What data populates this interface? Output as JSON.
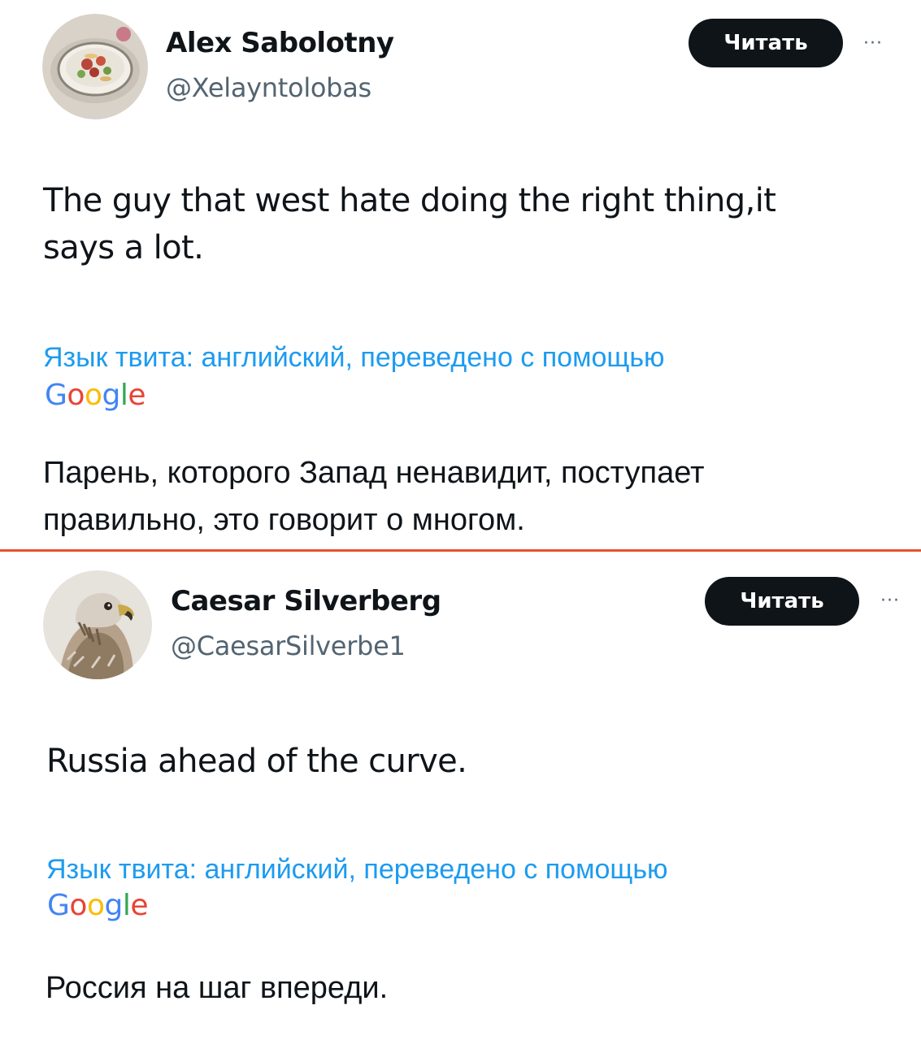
{
  "tweets": [
    {
      "display_name": "Alex Sabolotny",
      "handle": "@Xelayntolobas",
      "follow_label": "Читать",
      "more_label": "···",
      "text_line_1": "The guy that west hate doing the right thing,it",
      "text_line_2": "says a lot.",
      "translation_note": "Язык твита: английский, переведено с помощью",
      "google_letters": [
        "G",
        "o",
        "o",
        "g",
        "l",
        "e"
      ],
      "translated_line_1": "Парень, которого Запад ненавидит, поступает",
      "translated_line_2": "правильно, это говорит о многом.",
      "avatar_icon": "food-bowl-avatar"
    },
    {
      "display_name": "Caesar Silverberg",
      "handle": "@CaesarSilverbe1",
      "follow_label": "Читать",
      "more_label": "···",
      "text_line_1": "Russia ahead of the curve.",
      "translation_note": "Язык твита: английский, переведено с помощью",
      "google_letters": [
        "G",
        "o",
        "o",
        "g",
        "l",
        "e"
      ],
      "translated_line_1": "Россия на шаг впереди.",
      "avatar_icon": "hawk-avatar"
    }
  ],
  "colors": {
    "divider": "#e5532d",
    "link": "#1d9bf0",
    "follow_button_bg": "#0f1419",
    "handle_text": "#536471",
    "google_blue": "#4285f4",
    "google_red": "#ea4335",
    "google_yellow": "#fbbc05",
    "google_green": "#34a853"
  }
}
